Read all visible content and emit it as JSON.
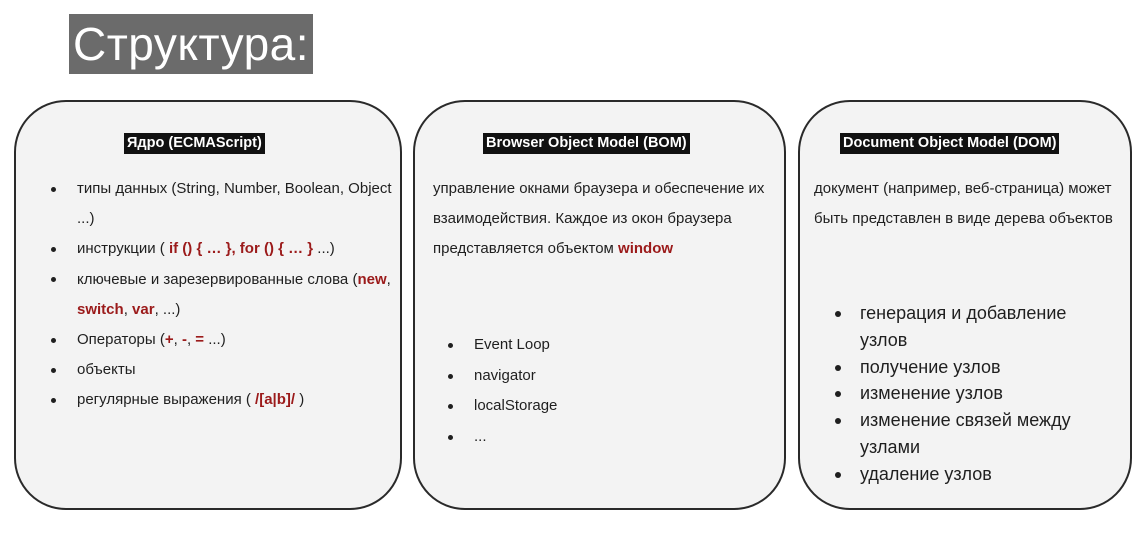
{
  "title": "Структура:",
  "core": {
    "heading": "Ядро (ECMAScript)",
    "items": [
      {
        "parts": [
          {
            "t": "типы данных (String, Number, Boolean, Object ...)"
          }
        ]
      },
      {
        "parts": [
          {
            "t": "инструкции ( "
          },
          {
            "t": "if () { … }, for () { … }",
            "k": true
          },
          {
            "t": " ...)"
          }
        ]
      },
      {
        "parts": [
          {
            "t": "ключевые и зарезервированные слова ("
          },
          {
            "t": "new",
            "k": true
          },
          {
            "t": ", "
          },
          {
            "t": "switch",
            "k": true
          },
          {
            "t": ", "
          },
          {
            "t": "var",
            "k": true
          },
          {
            "t": ", ...)"
          }
        ]
      },
      {
        "parts": [
          {
            "t": "Операторы ("
          },
          {
            "t": "+",
            "k": true
          },
          {
            "t": ", "
          },
          {
            "t": "-",
            "k": true
          },
          {
            "t": ", "
          },
          {
            "t": "=",
            "k": true
          },
          {
            "t": " ...)"
          }
        ]
      },
      {
        "parts": [
          {
            "t": "объекты"
          }
        ]
      },
      {
        "parts": [
          {
            "t": "регулярные выражения ( "
          },
          {
            "t": "/[a|b]/",
            "k": true
          },
          {
            "t": " )"
          }
        ]
      }
    ]
  },
  "bom": {
    "heading": "Browser Object Model (BOM)",
    "text_parts": [
      {
        "t": "управление окнами браузера и обеспечение их взаимодействия. Каждое из окон браузера представляется объектом "
      },
      {
        "t": "window",
        "k": true
      }
    ],
    "items": [
      "Event Loop",
      "navigator",
      "localStorage",
      "..."
    ]
  },
  "dom": {
    "heading": "Document Object Model (DOM)",
    "text": "документ (например, веб-страница) может быть представлен в виде дерева объектов",
    "items": [
      "генерация и добавление узлов",
      "получение узлов",
      "изменение узлов",
      "изменение связей между узлами",
      "удаление узлов"
    ]
  },
  "colors": {
    "keyword": "#9b1a1a",
    "title_bg": "#6b6b6b",
    "card_bg": "#f3f3f3",
    "heading_bg": "#111111"
  }
}
